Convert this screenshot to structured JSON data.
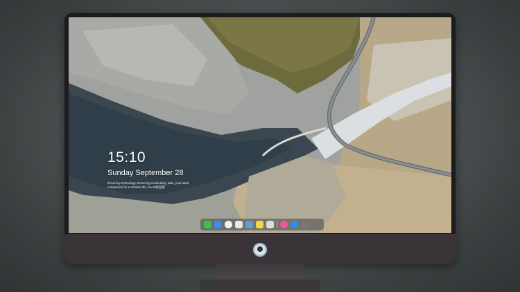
{
  "lock_screen": {
    "time": "15:10",
    "date": "Sunday September 28",
    "tagline": "Ensuring technology, Ensuring productivity, Mac, your ideal companion for a smarter life, boost经验感"
  },
  "dock": {
    "icons": [
      {
        "name": "messages-icon",
        "color": "#3cc24a"
      },
      {
        "name": "finder-icon",
        "color": "#3b8cf0"
      },
      {
        "name": "safari-icon",
        "color": "#f2f2f2"
      },
      {
        "name": "photos-icon",
        "color": "#e8e8e8"
      },
      {
        "name": "claquette-icon",
        "color": "#5aa0d8"
      },
      {
        "name": "notes-icon",
        "color": "#f5d54a"
      },
      {
        "name": "preview-icon",
        "color": "#dcdcdc"
      },
      {
        "name": "music-icon",
        "color": "#f0569a"
      },
      {
        "name": "app-store-icon",
        "color": "#2c8ef0"
      },
      {
        "name": "camera-icon",
        "color": "#777777"
      }
    ]
  }
}
